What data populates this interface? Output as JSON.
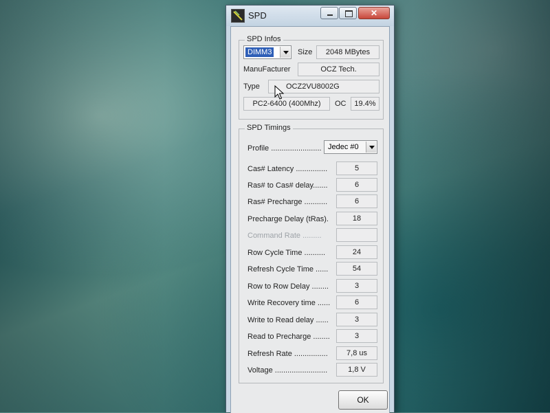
{
  "window": {
    "title": "SPD",
    "buttons": {
      "minimize": "–",
      "maximize": "□",
      "close": "✕"
    }
  },
  "spd_infos": {
    "legend": "SPD Infos",
    "slot": {
      "selected": "DIMM3"
    },
    "size_label": "Size",
    "size_value": "2048 MBytes",
    "manufacturer_label": "ManuFacturer",
    "manufacturer_value": "OCZ Tech.",
    "type_label": "Type",
    "type_value": "OCZ2VU8002G",
    "speed_value": "PC2-6400 (400Mhz)",
    "oc_label": "OC",
    "oc_value": "19.4%"
  },
  "spd_timings": {
    "legend": "SPD Timings",
    "profile_label": "Profile ........................",
    "profile_value": "Jedec #0",
    "rows": [
      {
        "label": "Cas# Latency ...............",
        "value": "5",
        "enabled": true
      },
      {
        "label": "Ras# to Cas# delay.......",
        "value": "6",
        "enabled": true
      },
      {
        "label": "Ras# Precharge ...........",
        "value": "6",
        "enabled": true
      },
      {
        "label": "Precharge Delay (tRas).",
        "value": "18",
        "enabled": true
      },
      {
        "label": "Command Rate .........",
        "value": "",
        "enabled": false
      },
      {
        "label": "Row Cycle Time ..........",
        "value": "24",
        "enabled": true
      },
      {
        "label": "Refresh Cycle Time ......",
        "value": "54",
        "enabled": true
      },
      {
        "label": "Row to Row Delay ........",
        "value": "3",
        "enabled": true
      },
      {
        "label": "Write Recovery time ......",
        "value": "6",
        "enabled": true
      },
      {
        "label": "Write to Read delay ......",
        "value": "3",
        "enabled": true
      },
      {
        "label": "Read to Precharge ........",
        "value": "3",
        "enabled": true
      },
      {
        "label": "Refresh Rate ................",
        "value": "7,8 us",
        "enabled": true
      },
      {
        "label": "Voltage .........................",
        "value": "1,8 V",
        "enabled": true
      }
    ]
  },
  "ok_label": "OK",
  "icons": {
    "app": "spd-app-icon",
    "cursor": "mouse-cursor-icon"
  }
}
